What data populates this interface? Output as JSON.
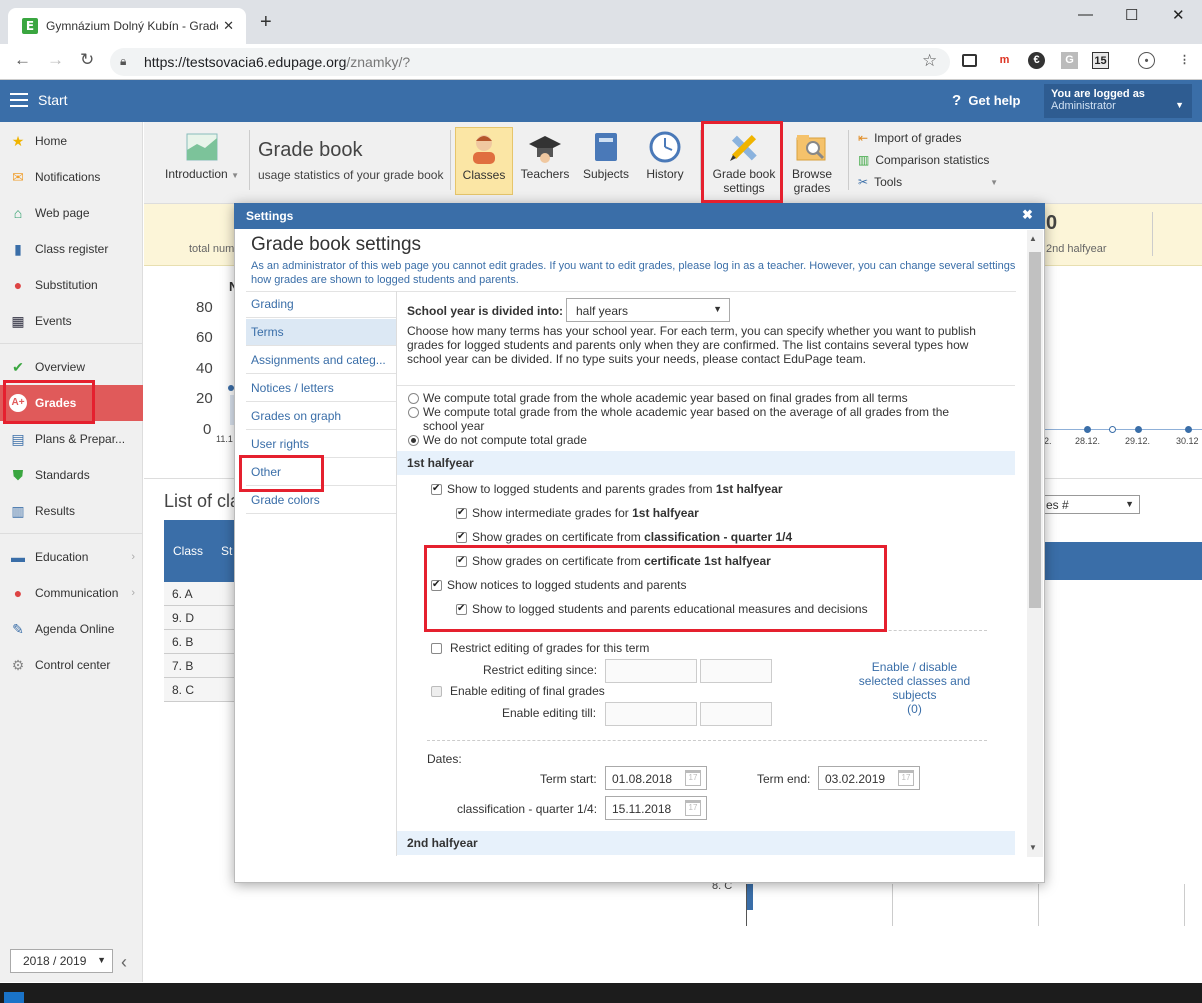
{
  "browser": {
    "tab_title": "Gymnázium Dolný Kubín - Grade",
    "url_host": "https://testsovacia6.edupage.org",
    "url_path": "/znamky/?",
    "extensions": [
      "m",
      "G",
      "15"
    ]
  },
  "header": {
    "start_label": "Start",
    "help_label": "Get help",
    "logged_as": "You are logged as",
    "user_role": "Administrator"
  },
  "sidebar": {
    "items": [
      {
        "label": "Home",
        "icon": "star-icon"
      },
      {
        "label": "Notifications",
        "icon": "envelope-icon"
      },
      {
        "label": "Web page",
        "icon": "home-icon"
      },
      {
        "label": "Class register",
        "icon": "book-icon"
      },
      {
        "label": "Substitution",
        "icon": "person-icon"
      },
      {
        "label": "Events",
        "icon": "calendar-icon"
      },
      {
        "label": "Overview",
        "icon": "check-circle-icon"
      },
      {
        "label": "Grades",
        "icon": "grade-icon"
      },
      {
        "label": "Plans & Prepar...",
        "icon": "clipboard-icon"
      },
      {
        "label": "Standards",
        "icon": "shield-check-icon"
      },
      {
        "label": "Results",
        "icon": "bar-chart-icon"
      },
      {
        "label": "Education",
        "icon": "education-icon"
      },
      {
        "label": "Communication",
        "icon": "chat-icon"
      },
      {
        "label": "Agenda Online",
        "icon": "pen-icon"
      },
      {
        "label": "Control center",
        "icon": "gear-icon"
      }
    ],
    "school_year": "2018 / 2019"
  },
  "toolbar": {
    "introduction": "Introduction",
    "title": "Grade book",
    "subtitle": "usage statistics of your grade book",
    "classes": "Classes",
    "teachers": "Teachers",
    "subjects": "Subjects",
    "history": "History",
    "grade_book_settings": [
      "Grade book",
      "settings"
    ],
    "browse_grades": [
      "Browse",
      "grades"
    ],
    "import": "Import of grades",
    "comparison": "Comparison statistics",
    "tools": "Tools"
  },
  "background": {
    "stat_left_label": "total num",
    "stat_left_value": "4",
    "stat_right_label": "2nd halfyear",
    "stat_right_value": "0",
    "yaxis": [
      "80",
      "60",
      "40",
      "20",
      "0"
    ],
    "first_date": "11.1",
    "dates": [
      "2.",
      "28.12.",
      "29.12.",
      "30.12"
    ],
    "list_title": "List of cla",
    "table_header": "Class",
    "table_header2": "St",
    "classes": [
      "6. A",
      "9. D",
      "6. B",
      "7. B",
      "8. C"
    ],
    "select_value": "es #",
    "bottom_label": "8. C"
  },
  "dialog": {
    "header": "Settings",
    "title": "Grade book settings",
    "note": "As an administrator of this web page you cannot edit grades. If you want to edit grades, please log in as a teacher. However, you can change several settings how grades are shown to logged students and parents.",
    "nav": [
      "Grading",
      "Terms",
      "Assignments and categ...",
      "Notices / letters",
      "Grades on graph",
      "User rights",
      "Other",
      "Grade colors"
    ],
    "division_label": "School year is divided into:",
    "division_value": "half years",
    "division_help": "Choose how many terms has your school year. For each term, you can specify whether you want to publish grades for logged students and parents only when they are confirmed. The list contains several types how school year can be divided. If no type suits your needs, please contact EduPage team.",
    "radio1": "We compute total grade from the whole academic year based on final grades from all terms",
    "radio2a": "We compute total grade from the whole academic year based on the average of all grades from the",
    "radio2b": "school year",
    "radio3": "We do not compute total grade",
    "term1": "1st halfyear",
    "show_grades_pre": "Show to logged students and parents grades from",
    "show_grades_bold": "1st halfyear",
    "show_intermediate_pre": "Show intermediate grades for",
    "show_intermediate_bold": "1st halfyear",
    "cert_q_pre": "Show grades on certificate from",
    "cert_q_bold": "classification - quarter 1/4",
    "cert_h_pre": "Show grades on certificate from",
    "cert_h_bold": "certificate 1st halfyear",
    "notices": "Show notices to logged students and parents",
    "measures": "Show to logged students and parents educational measures and decisions",
    "restrict": "Restrict editing of grades for this term",
    "restrict_since": "Restrict editing since:",
    "enable_final": "Enable editing of final grades",
    "enable_till": "Enable editing till:",
    "enable_disable_link": [
      "Enable / disable",
      "selected classes and",
      "subjects",
      "(0)"
    ],
    "dates_label": "Dates:",
    "term_start_label": "Term start:",
    "term_start": "01.08.2018",
    "term_end_label": "Term end:",
    "term_end": "03.02.2019",
    "quarter_label": "classification - quarter 1/4:",
    "quarter_date": "15.11.2018",
    "term2": "2nd halfyear"
  },
  "colors": {
    "header_blue": "#3a6ea8",
    "grades_active": "#e05a5a",
    "highlight_red": "#e5202e",
    "stats_band": "#fcf5d8"
  }
}
